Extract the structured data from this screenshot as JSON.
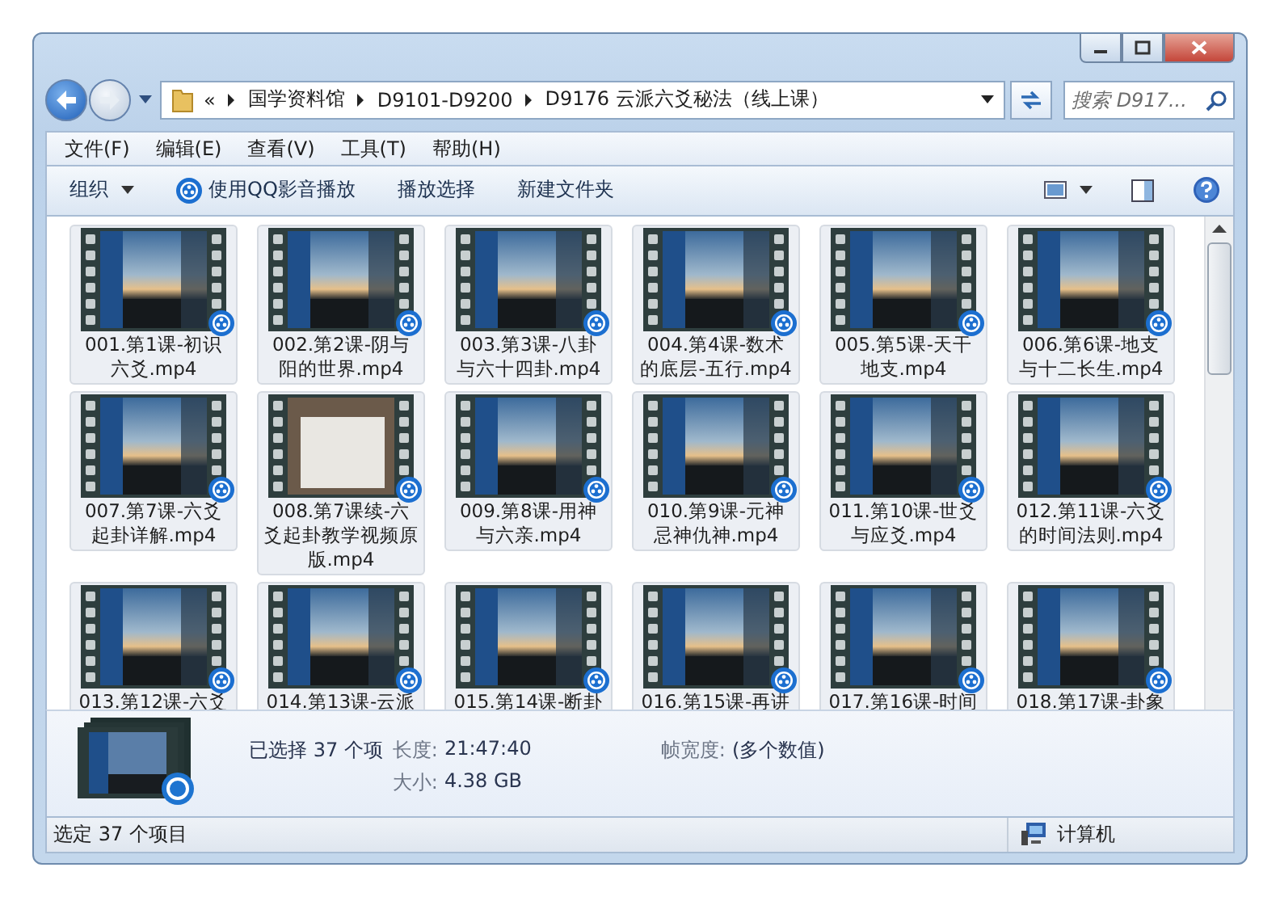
{
  "address_bar": {
    "overflow": "«",
    "path": [
      "国学资料馆",
      "D9101-D9200",
      "D9176 云派六爻秘法（线上课）"
    ]
  },
  "search": {
    "placeholder": "搜索 D917..."
  },
  "menu": [
    "文件(F)",
    "编辑(E)",
    "查看(V)",
    "工具(T)",
    "帮助(H)"
  ],
  "toolbar": [
    {
      "label": "组织",
      "kind": "dropdown"
    },
    {
      "label": "使用QQ影音播放",
      "kind": "player"
    },
    {
      "label": "播放选择",
      "kind": "plain"
    },
    {
      "label": "新建文件夹",
      "kind": "plain"
    }
  ],
  "files": [
    {
      "name": "001.第1课-初识六爻.mp4",
      "kind": "sky",
      "selected": true
    },
    {
      "name": "002.第2课-阴与阳的世界.mp4",
      "kind": "sky",
      "selected": true
    },
    {
      "name": "003.第3课-八卦与六十四卦.mp4",
      "kind": "sky",
      "selected": true
    },
    {
      "name": "004.第4课-数术的底层-五行.mp4",
      "kind": "sky",
      "selected": true
    },
    {
      "name": "005.第5课-天干地支.mp4",
      "kind": "sky",
      "selected": true
    },
    {
      "name": "006.第6课-地支与十二长生.mp4",
      "kind": "sky",
      "selected": true
    },
    {
      "name": "007.第7课-六爻起卦详解.mp4",
      "kind": "sky",
      "selected": true
    },
    {
      "name": "008.第7课续-六爻起卦教学视频原版.mp4",
      "kind": "photo",
      "selected": true
    },
    {
      "name": "009.第8课-用神与六亲.mp4",
      "kind": "sky",
      "selected": true
    },
    {
      "name": "010.第9课-元神忌神仇神.mp4",
      "kind": "sky",
      "selected": true
    },
    {
      "name": "011.第10课-世爻与应爻.mp4",
      "kind": "sky",
      "selected": true
    },
    {
      "name": "012.第11课-六爻的时间法则.mp4",
      "kind": "sky",
      "selected": true
    },
    {
      "name": "013.第12课-六爻",
      "kind": "sky",
      "selected": true
    },
    {
      "name": "014.第13课-云派",
      "kind": "sky",
      "selected": true
    },
    {
      "name": "015.第14课-断卦",
      "kind": "sky",
      "selected": true
    },
    {
      "name": "016.第15课-再讲",
      "kind": "sky",
      "selected": true
    },
    {
      "name": "017.第16课-时间",
      "kind": "sky",
      "selected": true
    },
    {
      "name": "018.第17课-卦象",
      "kind": "sky",
      "selected": true
    }
  ],
  "details": {
    "selection": "已选择 37 个项",
    "fields": [
      {
        "label": "长度:",
        "value": "21:47:40"
      },
      {
        "label": "帧宽度:",
        "value": "(多个数值)"
      },
      {
        "label": "大小:",
        "value": "4.38 GB"
      }
    ]
  },
  "status_bar": {
    "text": "选定 37 个项目",
    "location": "计算机"
  }
}
